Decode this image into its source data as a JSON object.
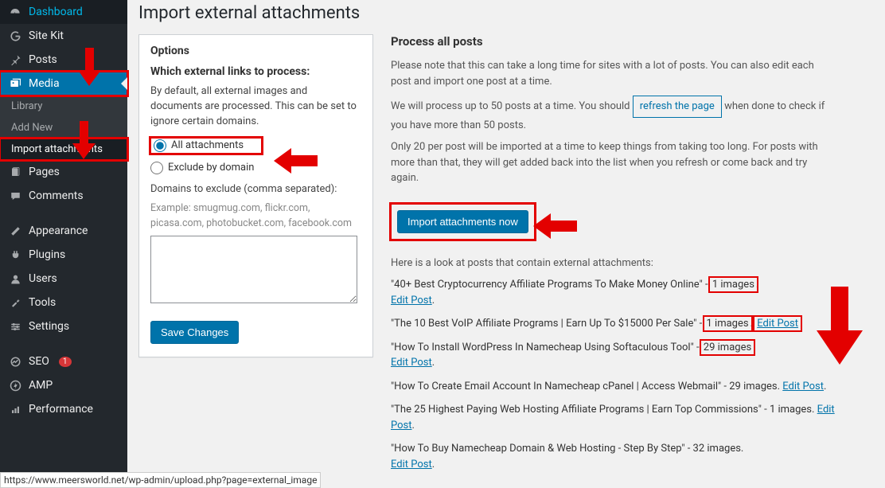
{
  "sidebar": {
    "dashboard": "Dashboard",
    "sitekit": "Site Kit",
    "posts": "Posts",
    "media": "Media",
    "library": "Library",
    "addnew": "Add New",
    "importatt": "Import attachments",
    "pages": "Pages",
    "comments": "Comments",
    "appearance": "Appearance",
    "plugins": "Plugins",
    "users": "Users",
    "tools": "Tools",
    "settings": "Settings",
    "seo": "SEO",
    "seo_badge": "1",
    "amp": "AMP",
    "performance": "Performance"
  },
  "page": {
    "title": "Import external attachments"
  },
  "options": {
    "heading": "Options",
    "which_heading": "Which external links to process:",
    "default_msg": "By default, all external images and documents are processed. This can be set to ignore certain domains.",
    "radio_all": "All attachments",
    "radio_exclude": "Exclude by domain",
    "domains_label": "Domains to exclude (comma separated):",
    "example": "Example: smugmug.com, flickr.com, picasa.com, photobucket.com, facebook.com",
    "save_btn": "Save Changes"
  },
  "process": {
    "heading": "Process all posts",
    "note1": "Please note that this can take a long time for sites with a lot of posts. You can also edit each post and import one post at a time.",
    "note2a": "We will process up to 50 posts at a time. You should ",
    "refresh_btn": "refresh the page",
    "note2b": " when done to check if you have more than 50 posts.",
    "note3": "Only 20 per post will be imported at a time to keep things from taking too long. For posts with more than that, they will get added back into the list when you refresh or come back and try again.",
    "import_btn": "Import attachments now",
    "look_msg": "Here is a look at posts that contain external attachments:",
    "edit_link": "Edit Post",
    "posts": [
      {
        "title": "40+ Best Cryptocurrency Affiliate Programs To Make Money Online",
        "count": "1 images"
      },
      {
        "title": "The 10 Best VoIP Affiliate Programs | Earn Up To $15000 Per Sale",
        "count": "1 images"
      },
      {
        "title": "How To Install WordPress In Namecheap Using Softaculous Tool",
        "count": "29 images"
      },
      {
        "title": "How To Create Email Account In Namecheap cPanel | Access Webmail",
        "count": "29 images"
      },
      {
        "title": "The 25 Highest Paying Web Hosting Affiliate Programs | Earn Top Commissions",
        "count": "1 images"
      },
      {
        "title": "How To Buy Namecheap Domain & Web Hosting - Step By Step",
        "count": "32 images"
      }
    ]
  },
  "statusbar": "https://www.meersworld.net/wp-admin/upload.php?page=external_image"
}
